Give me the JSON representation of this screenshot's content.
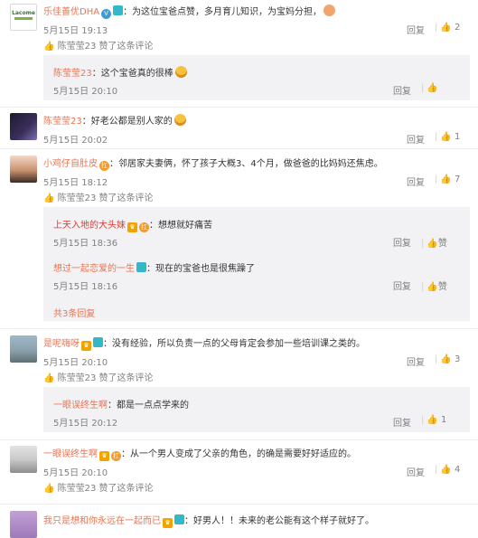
{
  "c1": {
    "name": "乐佳善优DHA",
    "text": "：为这位宝爸点赞，多月育儿知识，为宝妈分担，",
    "time": "5月15日 19:13",
    "reply": "回复",
    "likes": "2",
    "liked_by": "陈莹莹23 赞了这条评论",
    "avatar_text": "Lacome",
    "sub": {
      "name": "陈莹莹23",
      "text": "：这个宝爸真的很棒",
      "time": "5月15日 20:10",
      "reply": "回复",
      "likes": ""
    }
  },
  "c2": {
    "name": "陈莹莹23",
    "text": "：好老公都是别人家的",
    "time": "5月15日 20:02",
    "reply": "回复",
    "likes": "1"
  },
  "c3": {
    "name": "小鸡仔自肚皮",
    "text": "：邻居家夫妻俩，怀了孩子大概3、4个月，做爸爸的比妈妈还焦虑。",
    "time": "5月15日 18:12",
    "reply": "回复",
    "likes": "7",
    "liked_by": "陈莹莹23 赞了这条评论",
    "subs": [
      {
        "name": "上天入地的大头妹",
        "text": "：想想就好痛苦",
        "time": "5月15日 18:36",
        "reply": "回复",
        "likes": "赞"
      },
      {
        "name": "想过一起恋爱的一生",
        "text": "：现在的宝爸也是很焦躁了",
        "time": "5月15日 18:16",
        "reply": "回复",
        "likes": "赞"
      }
    ],
    "more": "共3条回复"
  },
  "c4": {
    "name": "是呢嗨呀",
    "text": "：没有经验，所以负责一点的父母肯定会参加一些培训课之类的。",
    "time": "5月15日 20:10",
    "reply": "回复",
    "likes": "3",
    "liked_by": "陈莹莹23 赞了这条评论",
    "sub": {
      "name": "一眼误终生啊",
      "text": "：都是一点点学来的",
      "time": "5月15日 20:12",
      "reply": "回复",
      "likes": "1"
    }
  },
  "c5": {
    "name": "一眼误终生啊",
    "text": "：从一个男人变成了父亲的角色，的确是需要好好适应的。",
    "time": "5月15日 20:10",
    "reply": "回复",
    "likes": "4",
    "liked_by": "陈莹莹23 赞了这条评论"
  },
  "c6": {
    "name": "我只是想和你永远在一起而已",
    "text": "：好男人！！未来的老公能有这个样子就好了。"
  },
  "badges": {
    "rank": "扛",
    "v": "V",
    "fan": "♛"
  },
  "colors": {
    "name": "#eb7350",
    "meta": "#808080",
    "sub_bg": "#f2f2f5"
  }
}
